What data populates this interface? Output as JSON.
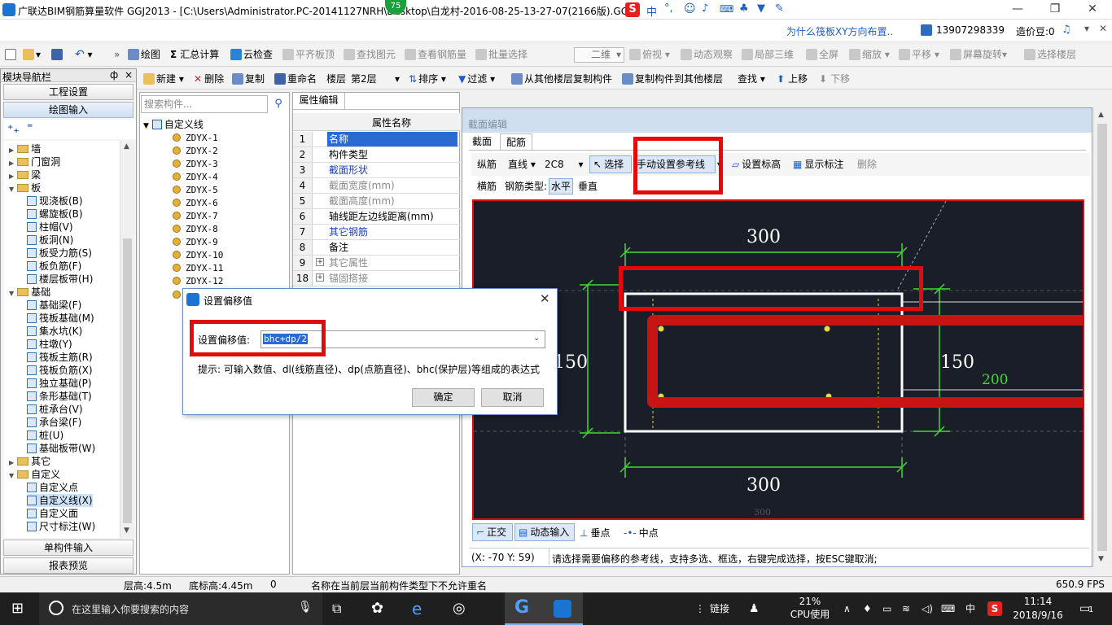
{
  "app": {
    "title": "广联达BIM钢筋算量软件 GGJ2013 - [C:\\Users\\Administrator.PC-20141127NRH\\Desktop\\白龙村-2016-08-25-13-27-07(2166版).GG",
    "badge": "75"
  },
  "promo": {
    "question": "为什么筏板XY方向布置..",
    "phone": "13907298339",
    "beans": "造价豆:0"
  },
  "toolbar1": {
    "draw": "绘图",
    "sum": "汇总计算",
    "cloud": "云检查",
    "flat": "平齐板顶",
    "find_elem": "查找图元",
    "check_rebar": "查看钢筋量",
    "batch": "批量选择",
    "view2d": "二维",
    "top": "俯视",
    "dynamic": "动态观察",
    "local3d": "局部三维",
    "full": "全屏",
    "zoom": "缩放",
    "pan": "平移",
    "rotate": "屏幕旋转",
    "select_floor": "选择楼层"
  },
  "toolbar2": {
    "new": "新建",
    "delete": "删除",
    "copy": "复制",
    "rename": "重命名",
    "floor_label": "楼层",
    "floor_value": "第2层",
    "sort": "排序",
    "filter": "过滤",
    "copy_from": "从其他楼层复制构件",
    "copy_to": "复制构件到其他楼层",
    "find": "查找",
    "up": "上移",
    "down": "下移"
  },
  "nav": {
    "header": "模块导航栏",
    "pin": "ф",
    "close": "×",
    "settings": "工程设置",
    "draw_input": "绘图输入",
    "single_input": "单构件输入",
    "report": "报表预览",
    "tree": [
      {
        "label": "墙",
        "kind": "folder",
        "level": 0
      },
      {
        "label": "门窗洞",
        "kind": "folder",
        "level": 0
      },
      {
        "label": "梁",
        "kind": "folder",
        "level": 0
      },
      {
        "label": "板",
        "kind": "folder",
        "level": 0
      },
      {
        "label": "现浇板(B)",
        "kind": "leaf",
        "level": 1
      },
      {
        "label": "螺旋板(B)",
        "kind": "leaf",
        "level": 1
      },
      {
        "label": "柱帽(V)",
        "kind": "leaf",
        "level": 1
      },
      {
        "label": "板洞(N)",
        "kind": "leaf",
        "level": 1
      },
      {
        "label": "板受力筋(S)",
        "kind": "leaf",
        "level": 1
      },
      {
        "label": "板负筋(F)",
        "kind": "leaf",
        "level": 1
      },
      {
        "label": "楼层板带(H)",
        "kind": "leaf",
        "level": 1
      },
      {
        "label": "基础",
        "kind": "folder",
        "level": 0
      },
      {
        "label": "基础梁(F)",
        "kind": "leaf",
        "level": 1
      },
      {
        "label": "筏板基础(M)",
        "kind": "leaf",
        "level": 1
      },
      {
        "label": "集水坑(K)",
        "kind": "leaf",
        "level": 1
      },
      {
        "label": "柱墩(Y)",
        "kind": "leaf",
        "level": 1
      },
      {
        "label": "筏板主筋(R)",
        "kind": "leaf",
        "level": 1
      },
      {
        "label": "筏板负筋(X)",
        "kind": "leaf",
        "level": 1
      },
      {
        "label": "独立基础(P)",
        "kind": "leaf",
        "level": 1
      },
      {
        "label": "条形基础(T)",
        "kind": "leaf",
        "level": 1
      },
      {
        "label": "桩承台(V)",
        "kind": "leaf",
        "level": 1
      },
      {
        "label": "承台梁(F)",
        "kind": "leaf",
        "level": 1
      },
      {
        "label": "桩(U)",
        "kind": "leaf",
        "level": 1
      },
      {
        "label": "基础板带(W)",
        "kind": "leaf",
        "level": 1
      },
      {
        "label": "其它",
        "kind": "folder",
        "level": 0
      },
      {
        "label": "自定义",
        "kind": "folder",
        "level": 0
      },
      {
        "label": "自定义点",
        "kind": "leaf",
        "level": 1
      },
      {
        "label": "自定义线(X)",
        "kind": "leaf",
        "level": 1
      },
      {
        "label": "自定义面",
        "kind": "leaf",
        "level": 1
      },
      {
        "label": "尺寸标注(W)",
        "kind": "leaf",
        "level": 1
      }
    ]
  },
  "components": {
    "search_placeholder": "搜索构件...",
    "root": "自定义线",
    "items": [
      "ZDYX-1",
      "ZDYX-2",
      "ZDYX-3",
      "ZDYX-4",
      "ZDYX-5",
      "ZDYX-6",
      "ZDYX-7",
      "ZDYX-8",
      "ZDYX-9",
      "ZDYX-10",
      "ZDYX-11",
      "ZDYX-12"
    ]
  },
  "props": {
    "tab": "属性编辑",
    "header": "属性名称",
    "rows": [
      {
        "num": "1",
        "label": "名称"
      },
      {
        "num": "2",
        "label": "构件类型"
      },
      {
        "num": "3",
        "label": "截面形状"
      },
      {
        "num": "4",
        "label": "截面宽度(mm)"
      },
      {
        "num": "5",
        "label": "截面高度(mm)"
      },
      {
        "num": "6",
        "label": "轴线距左边线距离(mm)"
      },
      {
        "num": "7",
        "label": "其它钢筋"
      },
      {
        "num": "8",
        "label": "备注"
      },
      {
        "num": "9",
        "label": "其它属性"
      },
      {
        "num": "18",
        "label": "锚固搭接"
      }
    ]
  },
  "section": {
    "title": "截面编辑",
    "tab_section": "截面",
    "tab_rebar": "配筋",
    "long_label": "纵筋",
    "line_type": "直线",
    "rebar_spec": "2C8",
    "select": "选择",
    "manual_ref": "手动设置参考线",
    "set_elev": "设置标高",
    "show_mark": "显示标注",
    "delete": "删除",
    "hoop_label": "横筋",
    "rebar_type_label": "钢筋类型:",
    "horizontal": "水平",
    "vertical": "垂直",
    "dim_top": "300",
    "dim_bottom": "300",
    "dim_bottom_faint": "300",
    "dim_left": "150",
    "dim_right": "150",
    "dim_green": "200",
    "ortho": "正交",
    "dyn_input": "动态输入",
    "perp": "垂点",
    "mid": "中点",
    "coords": "(X: -70 Y: 59)",
    "hint": "请选择需要偏移的参考线，支持多选、框选，右键完成选择，按ESC键取消;"
  },
  "dialog": {
    "title": "设置偏移值",
    "label": "设置偏移值:",
    "value": "bhc+dp/2",
    "tip": "提示: 可输入数值、dl(线筋直径)、dp(点筋直径)、bhc(保护层)等组成的表达式",
    "ok": "确定",
    "cancel": "取消"
  },
  "statusbar": {
    "floor_h": "层高:4.5m",
    "bottom_h": "底标高:4.45m",
    "zero": "0",
    "message": "名称在当前层当前构件类型下不允许重名",
    "fps": "650.9 FPS"
  },
  "taskbar": {
    "search": "在这里输入你要搜索的内容",
    "link": "链接",
    "cpu_pct": "21%",
    "cpu_label": "CPU使用",
    "ime": "中",
    "time": "11:14",
    "date": "2018/9/16",
    "notif": "1"
  },
  "colors": {
    "accent": "#0078d7",
    "highlight_red": "#e10b0b",
    "canvas_bg": "#1a1e28",
    "dim_green": "#43d832"
  }
}
